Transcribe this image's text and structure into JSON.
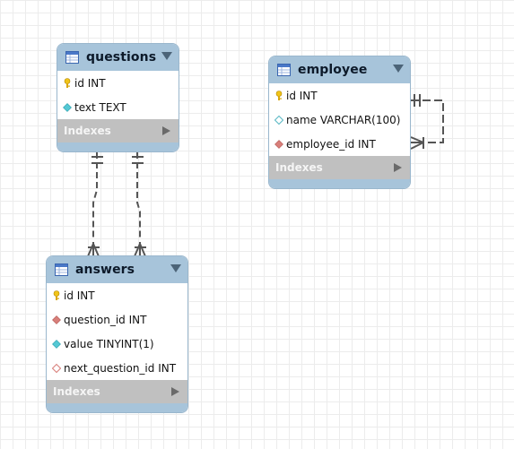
{
  "tables": {
    "questions": {
      "title": "questions",
      "columns": [
        {
          "text": "id INT",
          "icon": "primary-key-icon"
        },
        {
          "text": "text TEXT",
          "icon": "not-null-column-icon"
        }
      ],
      "indexes_label": "Indexes"
    },
    "employee": {
      "title": "employee",
      "columns": [
        {
          "text": "id INT",
          "icon": "primary-key-icon"
        },
        {
          "text": "name VARCHAR(100)",
          "icon": "nullable-column-icon"
        },
        {
          "text": "employee_id INT",
          "icon": "foreign-key-icon"
        }
      ],
      "indexes_label": "Indexes"
    },
    "answers": {
      "title": "answers",
      "columns": [
        {
          "text": "id INT",
          "icon": "primary-key-icon"
        },
        {
          "text": "question_id INT",
          "icon": "foreign-key-icon"
        },
        {
          "text": "value TINYINT(1)",
          "icon": "not-null-column-icon"
        },
        {
          "text": "next_question_id INT",
          "icon": "nullable-foreign-key-icon"
        }
      ],
      "indexes_label": "Indexes"
    }
  },
  "colors": {
    "header": "#a7c4da",
    "indexes": "#c0c0c0",
    "primary_key": "#f0c419",
    "not_null_column": "#55c8d4",
    "foreign_key": "#d87f7a",
    "relationship_line": "#555555"
  }
}
